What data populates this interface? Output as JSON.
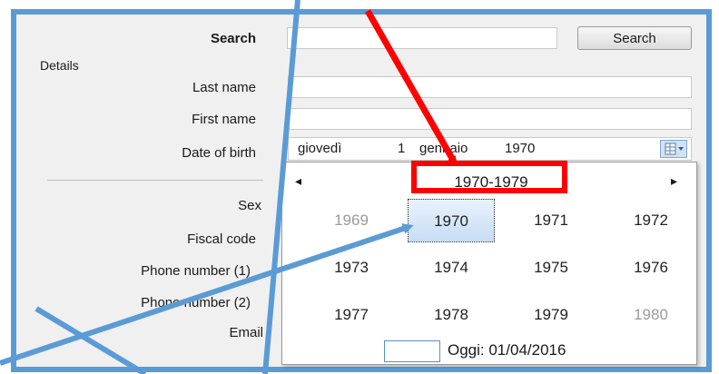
{
  "form": {
    "search_label": "Search",
    "search_value": "",
    "search_button": "Search",
    "details_label": "Details",
    "last_name_label": "Last name",
    "first_name_label": "First name",
    "dob_label": "Date of birth",
    "sex_label": "Sex",
    "fiscal_code_label": "Fiscal code",
    "phone1_label": "Phone number (1)",
    "phone2_label": "Phone number (2)",
    "email_label": "Email"
  },
  "date_picker": {
    "day_name": "giovedì",
    "day": "1",
    "month": "gennaio",
    "year": "1970"
  },
  "calendar": {
    "nav_prev": "◂",
    "nav_next": "▸",
    "decade_title": "1970-1979",
    "years": [
      {
        "label": "1969",
        "state": "dim"
      },
      {
        "label": "1970",
        "state": "selected"
      },
      {
        "label": "1971",
        "state": "normal"
      },
      {
        "label": "1972",
        "state": "normal"
      },
      {
        "label": "1973",
        "state": "normal"
      },
      {
        "label": "1974",
        "state": "normal"
      },
      {
        "label": "1975",
        "state": "normal"
      },
      {
        "label": "1976",
        "state": "normal"
      },
      {
        "label": "1977",
        "state": "normal"
      },
      {
        "label": "1978",
        "state": "normal"
      },
      {
        "label": "1979",
        "state": "normal"
      },
      {
        "label": "1980",
        "state": "dim"
      }
    ],
    "today_label": "Oggi: 01/04/2016"
  },
  "colors": {
    "annotation_red": "#ff0000",
    "annotation_blue": "#5b9bd5"
  }
}
